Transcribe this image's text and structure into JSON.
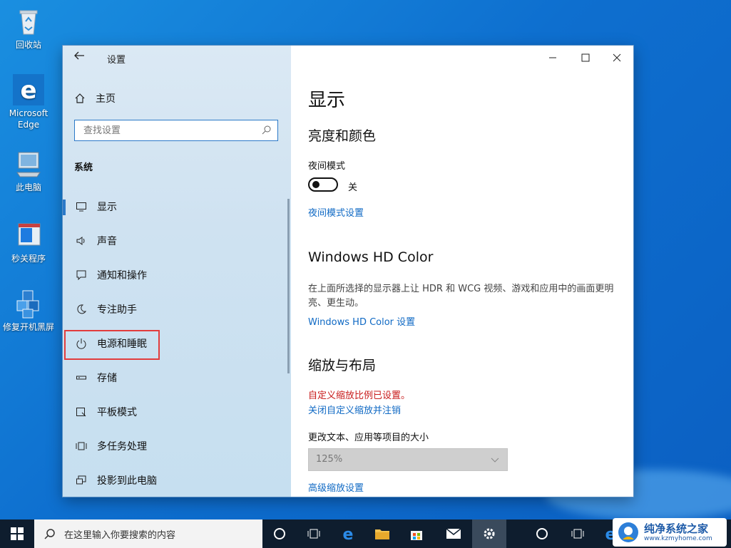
{
  "desktop": {
    "icons": [
      {
        "label": "回收站"
      },
      {
        "label": "Microsoft Edge"
      },
      {
        "label": "此电脑"
      },
      {
        "label": "秒关程序"
      },
      {
        "label": "修复开机黑屏"
      }
    ]
  },
  "sidebar": {
    "title": "设置",
    "home_label": "主页",
    "search_placeholder": "查找设置",
    "section": "系统",
    "items": [
      {
        "label": "显示",
        "icon": "monitor-icon",
        "active": true
      },
      {
        "label": "声音",
        "icon": "speaker-icon"
      },
      {
        "label": "通知和操作",
        "icon": "notification-icon"
      },
      {
        "label": "专注助手",
        "icon": "moon-icon"
      },
      {
        "label": "电源和睡眠",
        "icon": "power-icon",
        "highlighted": true
      },
      {
        "label": "存储",
        "icon": "storage-icon"
      },
      {
        "label": "平板模式",
        "icon": "tablet-icon"
      },
      {
        "label": "多任务处理",
        "icon": "multitask-icon"
      },
      {
        "label": "投影到此电脑",
        "icon": "project-icon"
      }
    ]
  },
  "main": {
    "title": "显示",
    "brightness_heading": "亮度和颜色",
    "night_mode_label": "夜间模式",
    "night_mode_state": "关",
    "night_mode_link": "夜间模式设置",
    "hd_heading": "Windows HD Color",
    "hd_desc": "在上面所选择的显示器上让 HDR 和 WCG 视频、游戏和应用中的画面更明亮、更生动。",
    "hd_link": "Windows HD Color 设置",
    "scale_heading": "缩放与布局",
    "custom_scale_warning": "自定义缩放比例已设置。",
    "custom_scale_link": "关闭自定义缩放并注销",
    "size_label": "更改文本、应用等项目的大小",
    "size_value": "125%",
    "advanced_link": "高级缩放设置"
  },
  "taskbar": {
    "search_placeholder": "在这里输入你要搜索的内容"
  },
  "watermark": {
    "title": "纯净系统之家",
    "url": "www.kzmyhome.com"
  },
  "colors": {
    "accent": "#0f69c4",
    "warning": "#c81b1b",
    "highlight_box": "#e23c3c"
  }
}
